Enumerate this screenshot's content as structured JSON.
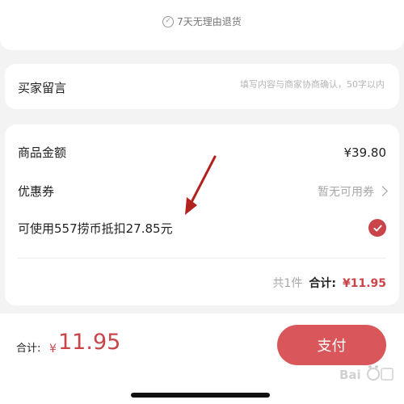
{
  "top": {
    "return_policy": "7天无理由退货"
  },
  "message": {
    "label": "买家留言",
    "placeholder": "填写内容与商家协商确认，50字以内"
  },
  "price": {
    "goods_label": "商品金额",
    "goods_value": "¥39.80",
    "coupon_label": "优惠券",
    "coupon_value": "暂无可用券",
    "deduct_label": "可使用557捞币抵扣27.85元",
    "deduct_selected": true,
    "summary_count": "共1件",
    "summary_label": "合计:",
    "summary_amount": "¥11.95"
  },
  "bottom": {
    "total_label": "合计:",
    "currency": "¥",
    "total_amount": "11.95",
    "pay_label": "支付"
  },
  "colors": {
    "accent": "#c9454a",
    "pay_button": "#d9575a",
    "annotation_arrow": "#b3211f"
  },
  "icons": {
    "return_policy": "check-circle-icon",
    "coupon": "chevron-right-icon",
    "deduct": "check-icon",
    "annotation": "arrow-icon"
  }
}
